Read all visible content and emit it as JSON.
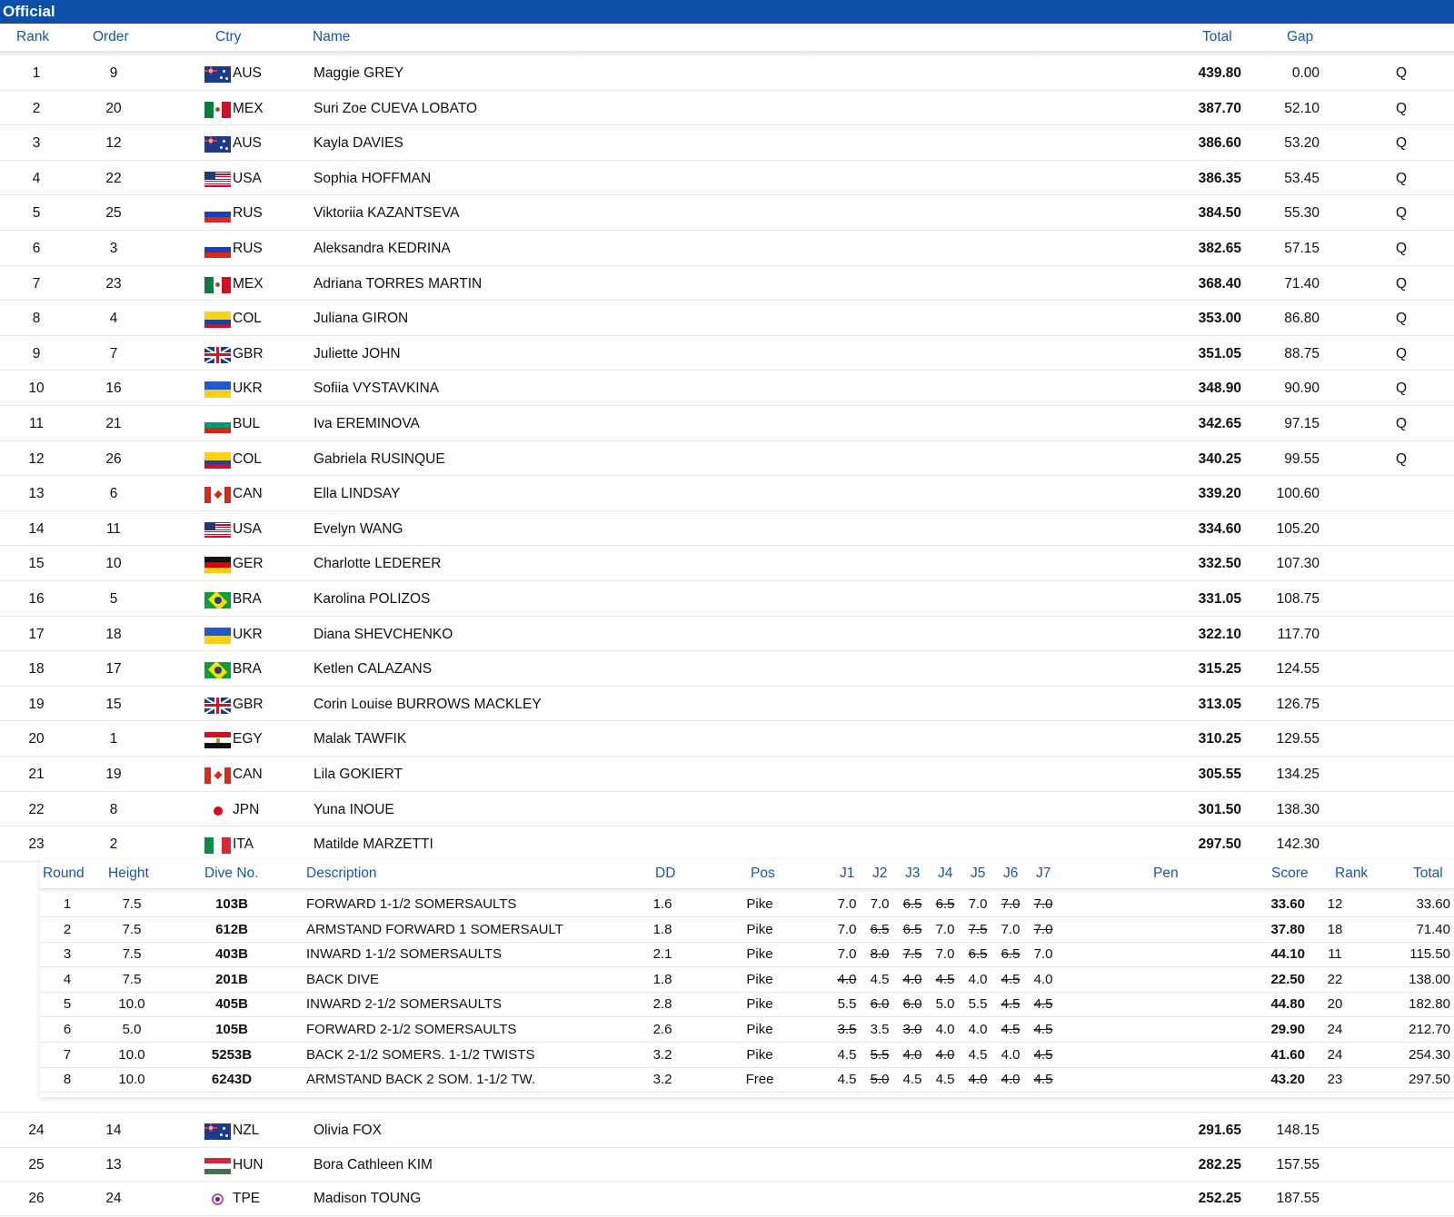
{
  "status": "Official",
  "columns": {
    "rank": "Rank",
    "order": "Order",
    "ctry": "Ctry",
    "name": "Name",
    "total": "Total",
    "gap": "Gap"
  },
  "rows": [
    {
      "rank": "1",
      "order": "9",
      "ctry": "AUS",
      "name": "Maggie GREY",
      "total": "439.80",
      "gap": "0.00",
      "q": "Q"
    },
    {
      "rank": "2",
      "order": "20",
      "ctry": "MEX",
      "name": "Suri Zoe CUEVA LOBATO",
      "total": "387.70",
      "gap": "52.10",
      "q": "Q"
    },
    {
      "rank": "3",
      "order": "12",
      "ctry": "AUS",
      "name": "Kayla DAVIES",
      "total": "386.60",
      "gap": "53.20",
      "q": "Q"
    },
    {
      "rank": "4",
      "order": "22",
      "ctry": "USA",
      "name": "Sophia HOFFMAN",
      "total": "386.35",
      "gap": "53.45",
      "q": "Q"
    },
    {
      "rank": "5",
      "order": "25",
      "ctry": "RUS",
      "name": "Viktoriia KAZANTSEVA",
      "total": "384.50",
      "gap": "55.30",
      "q": "Q"
    },
    {
      "rank": "6",
      "order": "3",
      "ctry": "RUS",
      "name": "Aleksandra KEDRINA",
      "total": "382.65",
      "gap": "57.15",
      "q": "Q"
    },
    {
      "rank": "7",
      "order": "23",
      "ctry": "MEX",
      "name": "Adriana TORRES MARTIN",
      "total": "368.40",
      "gap": "71.40",
      "q": "Q"
    },
    {
      "rank": "8",
      "order": "4",
      "ctry": "COL",
      "name": "Juliana GIRON",
      "total": "353.00",
      "gap": "86.80",
      "q": "Q"
    },
    {
      "rank": "9",
      "order": "7",
      "ctry": "GBR",
      "name": "Juliette JOHN",
      "total": "351.05",
      "gap": "88.75",
      "q": "Q"
    },
    {
      "rank": "10",
      "order": "16",
      "ctry": "UKR",
      "name": "Sofiia VYSTAVKINA",
      "total": "348.90",
      "gap": "90.90",
      "q": "Q"
    },
    {
      "rank": "11",
      "order": "21",
      "ctry": "BUL",
      "name": "Iva EREMINOVA",
      "total": "342.65",
      "gap": "97.15",
      "q": "Q"
    },
    {
      "rank": "12",
      "order": "26",
      "ctry": "COL",
      "name": "Gabriela RUSINQUE",
      "total": "340.25",
      "gap": "99.55",
      "q": "Q"
    },
    {
      "rank": "13",
      "order": "6",
      "ctry": "CAN",
      "name": "Ella LINDSAY",
      "total": "339.20",
      "gap": "100.60",
      "q": ""
    },
    {
      "rank": "14",
      "order": "11",
      "ctry": "USA",
      "name": "Evelyn WANG",
      "total": "334.60",
      "gap": "105.20",
      "q": ""
    },
    {
      "rank": "15",
      "order": "10",
      "ctry": "GER",
      "name": "Charlotte LEDERER",
      "total": "332.50",
      "gap": "107.30",
      "q": ""
    },
    {
      "rank": "16",
      "order": "5",
      "ctry": "BRA",
      "name": "Karolina POLIZOS",
      "total": "331.05",
      "gap": "108.75",
      "q": ""
    },
    {
      "rank": "17",
      "order": "18",
      "ctry": "UKR",
      "name": "Diana SHEVCHENKO",
      "total": "322.10",
      "gap": "117.70",
      "q": ""
    },
    {
      "rank": "18",
      "order": "17",
      "ctry": "BRA",
      "name": "Ketlen CALAZANS",
      "total": "315.25",
      "gap": "124.55",
      "q": ""
    },
    {
      "rank": "19",
      "order": "15",
      "ctry": "GBR",
      "name": "Corin Louise BURROWS MACKLEY",
      "total": "313.05",
      "gap": "126.75",
      "q": ""
    },
    {
      "rank": "20",
      "order": "1",
      "ctry": "EGY",
      "name": "Malak TAWFIK",
      "total": "310.25",
      "gap": "129.55",
      "q": ""
    },
    {
      "rank": "21",
      "order": "19",
      "ctry": "CAN",
      "name": "Lila GOKIERT",
      "total": "305.55",
      "gap": "134.25",
      "q": ""
    },
    {
      "rank": "22",
      "order": "8",
      "ctry": "JPN",
      "name": "Yuna INOUE",
      "total": "301.50",
      "gap": "138.30",
      "q": ""
    },
    {
      "rank": "23",
      "order": "2",
      "ctry": "ITA",
      "name": "Matilde MARZETTI",
      "total": "297.50",
      "gap": "142.30",
      "q": ""
    }
  ],
  "detail": {
    "columns": {
      "round": "Round",
      "height": "Height",
      "dive_no": "Dive No.",
      "description": "Description",
      "dd": "DD",
      "pos": "Pos",
      "j1": "J1",
      "j2": "J2",
      "j3": "J3",
      "j4": "J4",
      "j5": "J5",
      "j6": "J6",
      "j7": "J7",
      "pen": "Pen",
      "score": "Score",
      "rank": "Rank",
      "total": "Total"
    },
    "dives": [
      {
        "round": "1",
        "height": "7.5",
        "dive_no": "103B",
        "description": "FORWARD 1-1/2 SOMERSAULTS",
        "dd": "1.6",
        "pos": "Pike",
        "judges": [
          "7.0",
          "7.0",
          "6.5",
          "6.5",
          "7.0",
          "7.0",
          "7.0"
        ],
        "struck": [
          false,
          false,
          true,
          true,
          false,
          true,
          true
        ],
        "score": "33.60",
        "rank": "12",
        "total": "33.60"
      },
      {
        "round": "2",
        "height": "7.5",
        "dive_no": "612B",
        "description": "ARMSTAND FORWARD 1 SOMERSAULT",
        "dd": "1.8",
        "pos": "Pike",
        "judges": [
          "7.0",
          "6.5",
          "6.5",
          "7.0",
          "7.5",
          "7.0",
          "7.0"
        ],
        "struck": [
          false,
          true,
          true,
          false,
          true,
          false,
          true
        ],
        "score": "37.80",
        "rank": "18",
        "total": "71.40"
      },
      {
        "round": "3",
        "height": "7.5",
        "dive_no": "403B",
        "description": "INWARD 1-1/2 SOMERSAULTS",
        "dd": "2.1",
        "pos": "Pike",
        "judges": [
          "7.0",
          "8.0",
          "7.5",
          "7.0",
          "6.5",
          "6.5",
          "7.0"
        ],
        "struck": [
          false,
          true,
          true,
          false,
          true,
          true,
          false
        ],
        "score": "44.10",
        "rank": "11",
        "total": "115.50"
      },
      {
        "round": "4",
        "height": "7.5",
        "dive_no": "201B",
        "description": "BACK DIVE",
        "dd": "1.8",
        "pos": "Pike",
        "judges": [
          "4.0",
          "4.5",
          "4.0",
          "4.5",
          "4.0",
          "4.5",
          "4.0"
        ],
        "struck": [
          true,
          false,
          true,
          true,
          false,
          true,
          false
        ],
        "score": "22.50",
        "rank": "22",
        "total": "138.00"
      },
      {
        "round": "5",
        "height": "10.0",
        "dive_no": "405B",
        "description": "INWARD 2-1/2 SOMERSAULTS",
        "dd": "2.8",
        "pos": "Pike",
        "judges": [
          "5.5",
          "6.0",
          "6.0",
          "5.0",
          "5.5",
          "4.5",
          "4.5"
        ],
        "struck": [
          false,
          true,
          true,
          false,
          false,
          true,
          true
        ],
        "score": "44.80",
        "rank": "20",
        "total": "182.80"
      },
      {
        "round": "6",
        "height": "5.0",
        "dive_no": "105B",
        "description": "FORWARD 2-1/2 SOMERSAULTS",
        "dd": "2.6",
        "pos": "Pike",
        "judges": [
          "3.5",
          "3.5",
          "3.0",
          "4.0",
          "4.0",
          "4.5",
          "4.5"
        ],
        "struck": [
          true,
          false,
          true,
          false,
          false,
          true,
          true
        ],
        "score": "29.90",
        "rank": "24",
        "total": "212.70"
      },
      {
        "round": "7",
        "height": "10.0",
        "dive_no": "5253B",
        "description": "BACK 2-1/2 SOMERS. 1-1/2 TWISTS",
        "dd": "3.2",
        "pos": "Pike",
        "judges": [
          "4.5",
          "5.5",
          "4.0",
          "4.0",
          "4.5",
          "4.0",
          "4.5"
        ],
        "struck": [
          false,
          true,
          true,
          true,
          false,
          false,
          true
        ],
        "score": "41.60",
        "rank": "24",
        "total": "254.30"
      },
      {
        "round": "8",
        "height": "10.0",
        "dive_no": "6243D",
        "description": "ARMSTAND BACK 2 SOM. 1-1/2 TW.",
        "dd": "3.2",
        "pos": "Free",
        "judges": [
          "4.5",
          "5.0",
          "4.5",
          "4.5",
          "4.0",
          "4.0",
          "4.5"
        ],
        "struck": [
          false,
          true,
          false,
          false,
          true,
          true,
          true
        ],
        "score": "43.20",
        "rank": "23",
        "total": "297.50"
      }
    ]
  },
  "rows_after": [
    {
      "rank": "24",
      "order": "14",
      "ctry": "NZL",
      "name": "Olivia FOX",
      "total": "291.65",
      "gap": "148.15",
      "q": ""
    },
    {
      "rank": "25",
      "order": "13",
      "ctry": "HUN",
      "name": "Bora Cathleen KIM",
      "total": "282.25",
      "gap": "157.55",
      "q": ""
    },
    {
      "rank": "26",
      "order": "24",
      "ctry": "TPE",
      "name": "Madison TOUNG",
      "total": "252.25",
      "gap": "187.55",
      "q": ""
    }
  ],
  "colors": {
    "header_bar": "#0b4fa8",
    "column_header_text": "#1857a8"
  }
}
